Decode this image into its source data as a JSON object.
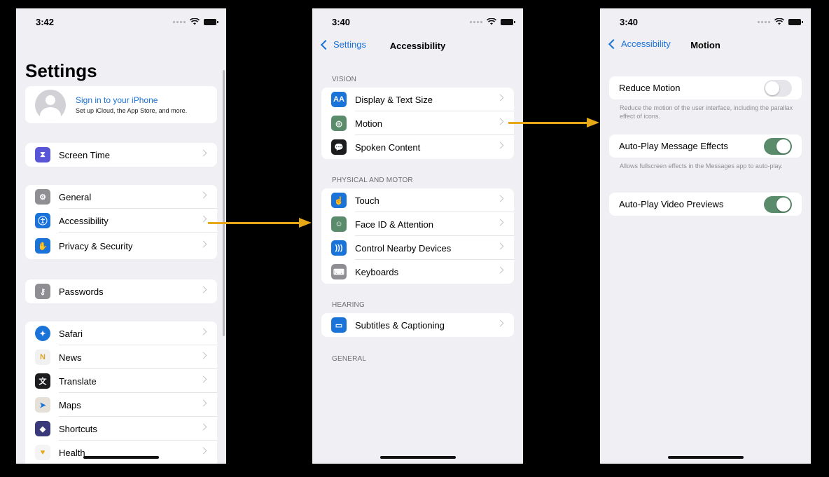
{
  "screen1": {
    "time": "3:42",
    "title": "Settings",
    "profile": {
      "title": "Sign in to your iPhone",
      "subtitle": "Set up iCloud, the App Store, and more."
    },
    "items": [
      {
        "label": "Screen Time",
        "icon": "hourglass-icon",
        "color": "#5856d6"
      },
      {
        "label": "General",
        "icon": "gear-icon",
        "color": "#8e8e93"
      },
      {
        "label": "Accessibility",
        "icon": "accessibility-icon",
        "color": "#1a73d9"
      },
      {
        "label": "Privacy & Security",
        "icon": "hand-icon",
        "color": "#1a73d9"
      },
      {
        "label": "Passwords",
        "icon": "key-icon",
        "color": "#8e8e93"
      },
      {
        "label": "Safari",
        "icon": "compass-icon",
        "color": "#1a73d9"
      },
      {
        "label": "News",
        "icon": "news-icon",
        "color": "#f1f1f1"
      },
      {
        "label": "Translate",
        "icon": "translate-icon",
        "color": "#1c1c1e"
      },
      {
        "label": "Maps",
        "icon": "map-icon",
        "color": "#e5e0d8"
      },
      {
        "label": "Shortcuts",
        "icon": "shortcuts-icon",
        "color": "#3a3a7a"
      },
      {
        "label": "Health",
        "icon": "heart-icon",
        "color": "#f4f4f4"
      }
    ]
  },
  "screen2": {
    "time": "3:40",
    "back": "Settings",
    "title": "Accessibility",
    "sections": [
      {
        "header": "VISION",
        "items": [
          {
            "label": "Display & Text Size",
            "icon": "text-size-icon",
            "color": "#1a73d9"
          },
          {
            "label": "Motion",
            "icon": "motion-icon",
            "color": "#5a8c6c"
          },
          {
            "label": "Spoken Content",
            "icon": "speech-bubble-icon",
            "color": "#1c1c1e"
          }
        ]
      },
      {
        "header": "PHYSICAL AND MOTOR",
        "items": [
          {
            "label": "Touch",
            "icon": "hand-pointer-icon",
            "color": "#1a73d9"
          },
          {
            "label": "Face ID & Attention",
            "icon": "face-id-icon",
            "color": "#5a8c6c"
          },
          {
            "label": "Control Nearby Devices",
            "icon": "wireless-icon",
            "color": "#1a73d9"
          },
          {
            "label": "Keyboards",
            "icon": "keyboard-icon",
            "color": "#8e8e93"
          }
        ]
      },
      {
        "header": "HEARING",
        "items": [
          {
            "label": "Subtitles & Captioning",
            "icon": "captions-icon",
            "color": "#1a73d9"
          }
        ]
      },
      {
        "header": "GENERAL",
        "items": []
      }
    ]
  },
  "screen3": {
    "time": "3:40",
    "back": "Accessibility",
    "title": "Motion",
    "settings": [
      {
        "label": "Reduce Motion",
        "on": false,
        "note": "Reduce the motion of the user interface, including the parallax effect of icons."
      },
      {
        "label": "Auto-Play Message Effects",
        "on": true,
        "note": "Allows fullscreen effects in the Messages app to auto-play."
      },
      {
        "label": "Auto-Play Video Previews",
        "on": true,
        "note": ""
      }
    ]
  },
  "colors": {
    "accent": "#1a73d9",
    "toggle_on": "#5a8c6c",
    "arrow": "#e6a817"
  }
}
